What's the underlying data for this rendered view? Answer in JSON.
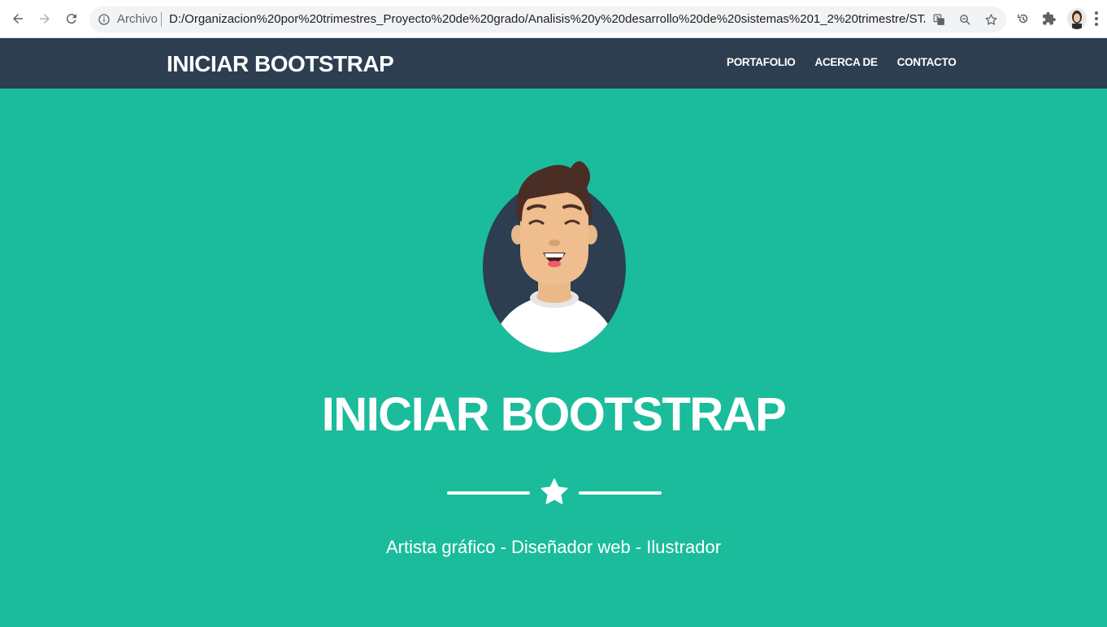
{
  "browser": {
    "scheme_label": "Archivo",
    "url": "D:/Organizacion%20por%20trimestres_Proyecto%20de%20grado/Analisis%20y%20desarrollo%20de%20sistemas%201_2%20trimestre/START%20B...",
    "icons": [
      "back-icon",
      "forward-icon",
      "reload-icon",
      "info-icon",
      "translate-icon",
      "zoom-icon",
      "bookmark-star-icon",
      "history-icon",
      "extensions-icon",
      "profile-avatar",
      "menu-icon"
    ]
  },
  "navbar": {
    "brand": "INICIAR BOOTSTRAP",
    "links": [
      "PORTAFOLIO",
      "ACERCA DE",
      "CONTACTO"
    ]
  },
  "masthead": {
    "title": "INICIAR BOOTSTRAP",
    "subtitle": "Artista gráfico - Diseñador web - Ilustrador",
    "divider_icon": "star-icon"
  },
  "colors": {
    "navbar": "#2c3e50",
    "masthead": "#1abc9c",
    "text": "#ffffff"
  }
}
